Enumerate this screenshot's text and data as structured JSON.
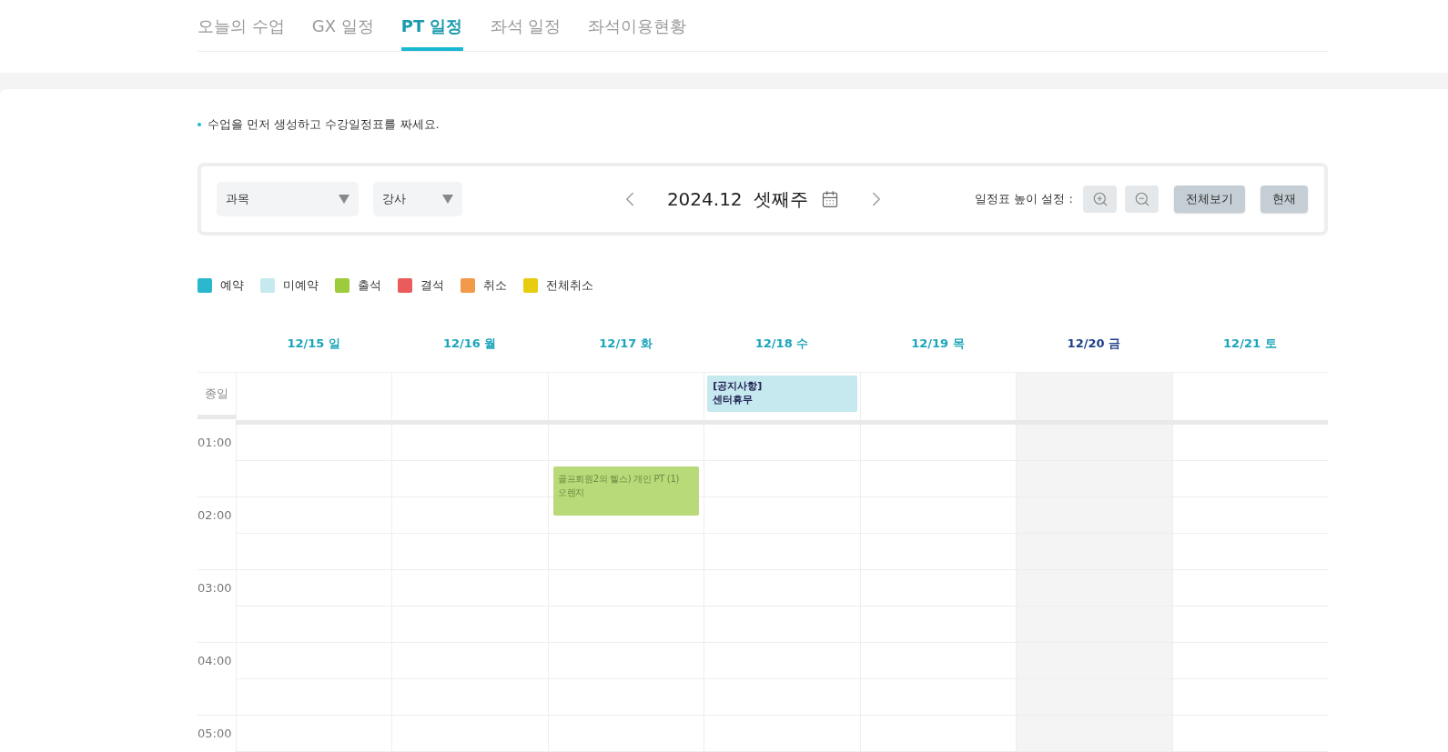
{
  "tabs": [
    {
      "label": "오늘의 수업",
      "selected": false
    },
    {
      "label": "GX 일정",
      "selected": false
    },
    {
      "label": "PT 일정",
      "selected": true
    },
    {
      "label": "좌석 일정",
      "selected": false
    },
    {
      "label": "좌석이용현황",
      "selected": false
    }
  ],
  "notice": "수업을 먼저 생성하고 수강일정표를 짜세요.",
  "filters": {
    "subject": "과목",
    "instructor": "강사"
  },
  "week": {
    "title": "2024.12  셋째주"
  },
  "height_setting": {
    "label": "일정표 높이 설정 :",
    "buttons": [
      "전체보기",
      "현재"
    ]
  },
  "legend": [
    {
      "label": "예약",
      "color": "#2bb7cc"
    },
    {
      "label": "미예약",
      "color": "#c5e9ee"
    },
    {
      "label": "출석",
      "color": "#9ccc3c"
    },
    {
      "label": "결석",
      "color": "#ea5b5b"
    },
    {
      "label": "취소",
      "color": "#f09a4a"
    },
    {
      "label": "전체취소",
      "color": "#e8cc10"
    }
  ],
  "all_day_label": "종일",
  "hours": [
    "01:00",
    "02:00",
    "03:00",
    "04:00",
    "05:00"
  ],
  "days": [
    {
      "label": "12/15 일",
      "today": false
    },
    {
      "label": "12/16 월",
      "today": false
    },
    {
      "label": "12/17 화",
      "today": false,
      "events": [
        {
          "title": "골프회원2의 헬스) 개인 PT (1)",
          "subtitle": "오렌지",
          "color": "#b8da78"
        }
      ]
    },
    {
      "label": "12/18 수",
      "today": false,
      "all_day": [
        {
          "title": "[공지사항]",
          "subtitle": "센터휴무",
          "color": "#c5e9ee"
        }
      ]
    },
    {
      "label": "12/19 목",
      "today": false
    },
    {
      "label": "12/20 금",
      "today": true
    },
    {
      "label": "12/21 토",
      "today": false
    }
  ]
}
